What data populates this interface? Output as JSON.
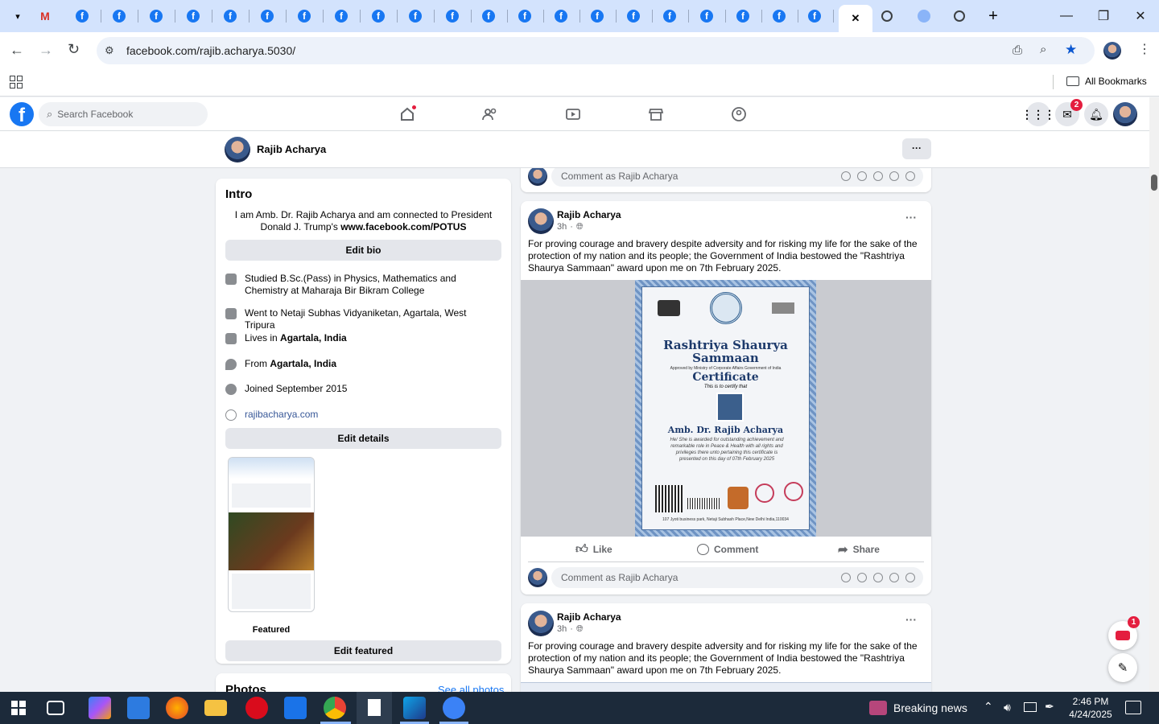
{
  "browser": {
    "url": "facebook.com/rajib.acharya.5030/",
    "bookmarks_label": "All Bookmarks",
    "tab_close": "✕",
    "new_tab": "+",
    "controls": {
      "minimize": "—",
      "restore": "❐",
      "close": "✕"
    }
  },
  "facebook": {
    "search_placeholder": "Search Facebook",
    "messenger_badge": "2",
    "profile_name": "Rajib Acharya",
    "more_button": "···"
  },
  "intro": {
    "title": "Intro",
    "bio": "I am Amb. Dr. Rajib Acharya and am connected to President Donald J. Trump's",
    "bio_link": "www.facebook.com/POTUS",
    "edit_bio": "Edit bio",
    "items": [
      {
        "icon": "graduation-cap-icon",
        "text": "Studied B.Sc.(Pass) in Physics, Mathematics and Chemistry at Maharaja Bir Bikram College"
      },
      {
        "icon": "graduation-cap-icon",
        "text": "Went to Netaji Subhas Vidyaniketan, Agartala, West Tripura"
      },
      {
        "icon": "home-icon",
        "prefix": "Lives in ",
        "bold": "Agartala, India"
      },
      {
        "icon": "location-pin-icon",
        "prefix": "From ",
        "bold": "Agartala, India"
      },
      {
        "icon": "clock-icon",
        "text": "Joined September 2015"
      },
      {
        "icon": "globe-icon",
        "link": "rajibacharya.com"
      }
    ],
    "edit_details": "Edit details",
    "featured_label": "Featured",
    "edit_featured": "Edit featured",
    "photos_title": "Photos",
    "see_all_photos": "See all photos"
  },
  "posts": {
    "comment_placeholder": "Comment as Rajib Acharya",
    "items": [
      {
        "author": "Rajib Acharya",
        "time": "3h",
        "text": "For proving courage and bravery despite adversity and for risking my life for the sake of  the protection of  my nation and its people; the Government of India bestowed the \"Rashtriya Shaurya Sammaan\" award upon me on 7th February 2025."
      },
      {
        "author": "Rajib Acharya",
        "time": "3h",
        "text": "For proving courage and bravery despite adversity and for risking my life for the sake of  the protection of  my nation and its people; the Government of India bestowed the \"Rashtriya Shaurya Sammaan\" award upon me on 7th February 2025."
      }
    ],
    "actions": {
      "like": "Like",
      "comment": "Comment",
      "share": "Share"
    }
  },
  "certificate": {
    "title1": "Rashtriya Shaurya",
    "title2": "Sammaan",
    "approved": "Approved by Ministry of Corporate Affairs Government of India",
    "cert": "Certificate",
    "certify": "This is to certify that",
    "name": "Amb. Dr. Rajib Acharya",
    "body": "He/ She is awarded for outstanding achievement and remarkable role in Peace & Health with all rights and privileges there unto pertaining this certificate is presented on this day of 07th February 2025",
    "address": "107 Jyoti business park, Netaji Subhash Place,New Delhi India,110034"
  },
  "floating": {
    "news_badge": "1"
  },
  "taskbar": {
    "news": "Breaking news",
    "time": "2:46 PM",
    "date": "4/24/2025"
  },
  "colors": {
    "fb_blue": "#1877f2",
    "link": "#385898",
    "tabstrip": "#d3e3fd"
  }
}
